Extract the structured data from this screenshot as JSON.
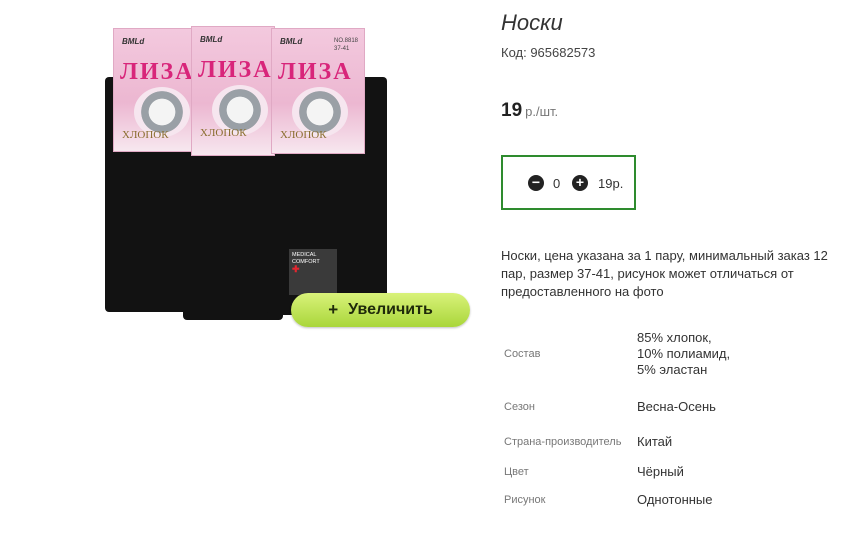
{
  "product": {
    "title": "Носки",
    "code": "Код: 965682573",
    "price_value": "19",
    "price_unit": "р./шт.",
    "description": "Носки, цена указана за 1 пару, минимальный заказ 12 пар, размер 37-41, рисунок может отличаться от предоставленного на фото"
  },
  "image": {
    "brand": "BMLd",
    "card_no": "NO.8818",
    "card_size": "37-41",
    "card_title": "ЛИЗА",
    "card_cotton": "ХЛОПОК",
    "medical_line1": "MEDICAL",
    "medical_line2": "COMFORT",
    "zoom_button": "Увеличить",
    "zoom_plus": "+"
  },
  "quantity": {
    "minus": "−",
    "plus": "+",
    "value": "0",
    "sum": "19р."
  },
  "properties": [
    {
      "key": "Состав",
      "value": "85% хлопок, 10% полиамид, 5% эластан"
    },
    {
      "key": "Сезон",
      "value": "Весна-Осень"
    },
    {
      "key": "Страна-производитель",
      "value": "Китай"
    },
    {
      "key": "Цвет",
      "value": "Чёрный"
    },
    {
      "key": "Рисунок",
      "value": "Однотонные"
    }
  ],
  "colors": {
    "accent_green": "#2e8b2e",
    "button_green": "#a9d63a",
    "card_pink": "#ecb7d1",
    "title_magenta": "#d8257a"
  }
}
